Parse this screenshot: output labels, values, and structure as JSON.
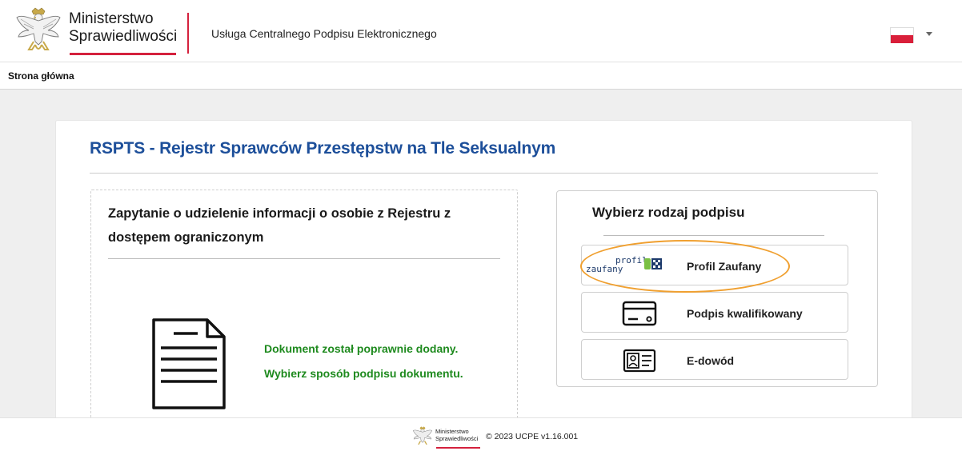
{
  "header": {
    "ministry_line1": "Ministerstwo",
    "ministry_line2": "Sprawiedliwości",
    "service_name": "Usługa Centralnego Podpisu Elektronicznego",
    "language_flag": "flag-poland-icon",
    "accent_color": "#d4213d"
  },
  "nav": {
    "home_label": "Strona główna"
  },
  "main": {
    "title": "RSPTS - Rejestr Sprawców Przestępstw na Tle Seksualnym",
    "title_color": "#1d4f9a",
    "inquiry": {
      "title": "Zapytanie o udzielenie informacji o osobie z Rejestru z dostępem ograniczonym",
      "document_icon": "document-icon",
      "success_line1": "Dokument został poprawnie dodany.",
      "success_line2": "Wybierz sposób podpisu dokumentu.",
      "success_color": "#1e8a1e"
    },
    "signature": {
      "title": "Wybierz rodzaj podpisu",
      "options": [
        {
          "label": "Profil Zaufany",
          "icon": "profil-zaufany-logo",
          "logo_text_top": "profil",
          "logo_text_bottom": "zaufany",
          "highlighted": true
        },
        {
          "label": "Podpis kwalifikowany",
          "icon": "credit-card-icon"
        },
        {
          "label": "E-dowód",
          "icon": "id-card-icon"
        }
      ],
      "highlight_color": "#f0a030"
    }
  },
  "footer": {
    "ministry_line1": "Ministerstwo",
    "ministry_line2": "Sprawiedliwości",
    "copyright": "© 2023 UCPE v1.16.001"
  }
}
